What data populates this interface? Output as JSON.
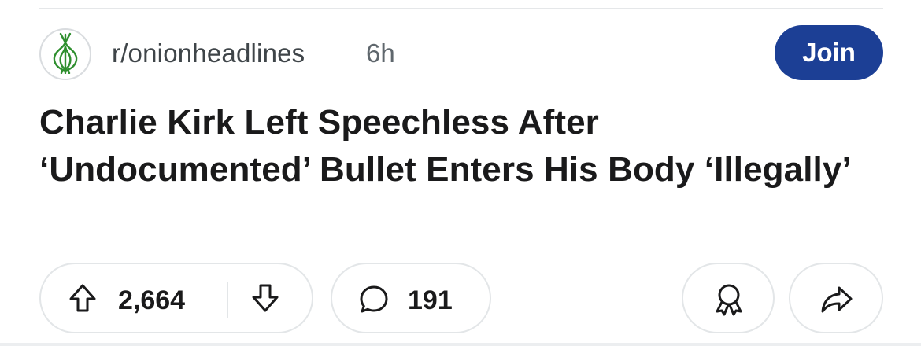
{
  "post": {
    "subreddit": "r/onionheadlines",
    "age": "6h",
    "join_label": "Join",
    "title": "Charlie Kirk Left Speechless After ‘Undocumented’ Bullet Enters His Body ‘Illegally’"
  },
  "actions": {
    "upvotes": "2,664",
    "comments": "191"
  },
  "icons": {
    "avatar": "onion-icon",
    "upvote": "arrow-up-icon",
    "downvote": "arrow-down-icon",
    "comment": "comment-bubble-icon",
    "award": "award-icon",
    "share": "share-arrow-icon"
  },
  "colors": {
    "join_button": "#1c3f95",
    "onion_logo": "#2f8f2f",
    "text_primary": "#1a1a1b",
    "text_secondary": "#5f676d"
  }
}
